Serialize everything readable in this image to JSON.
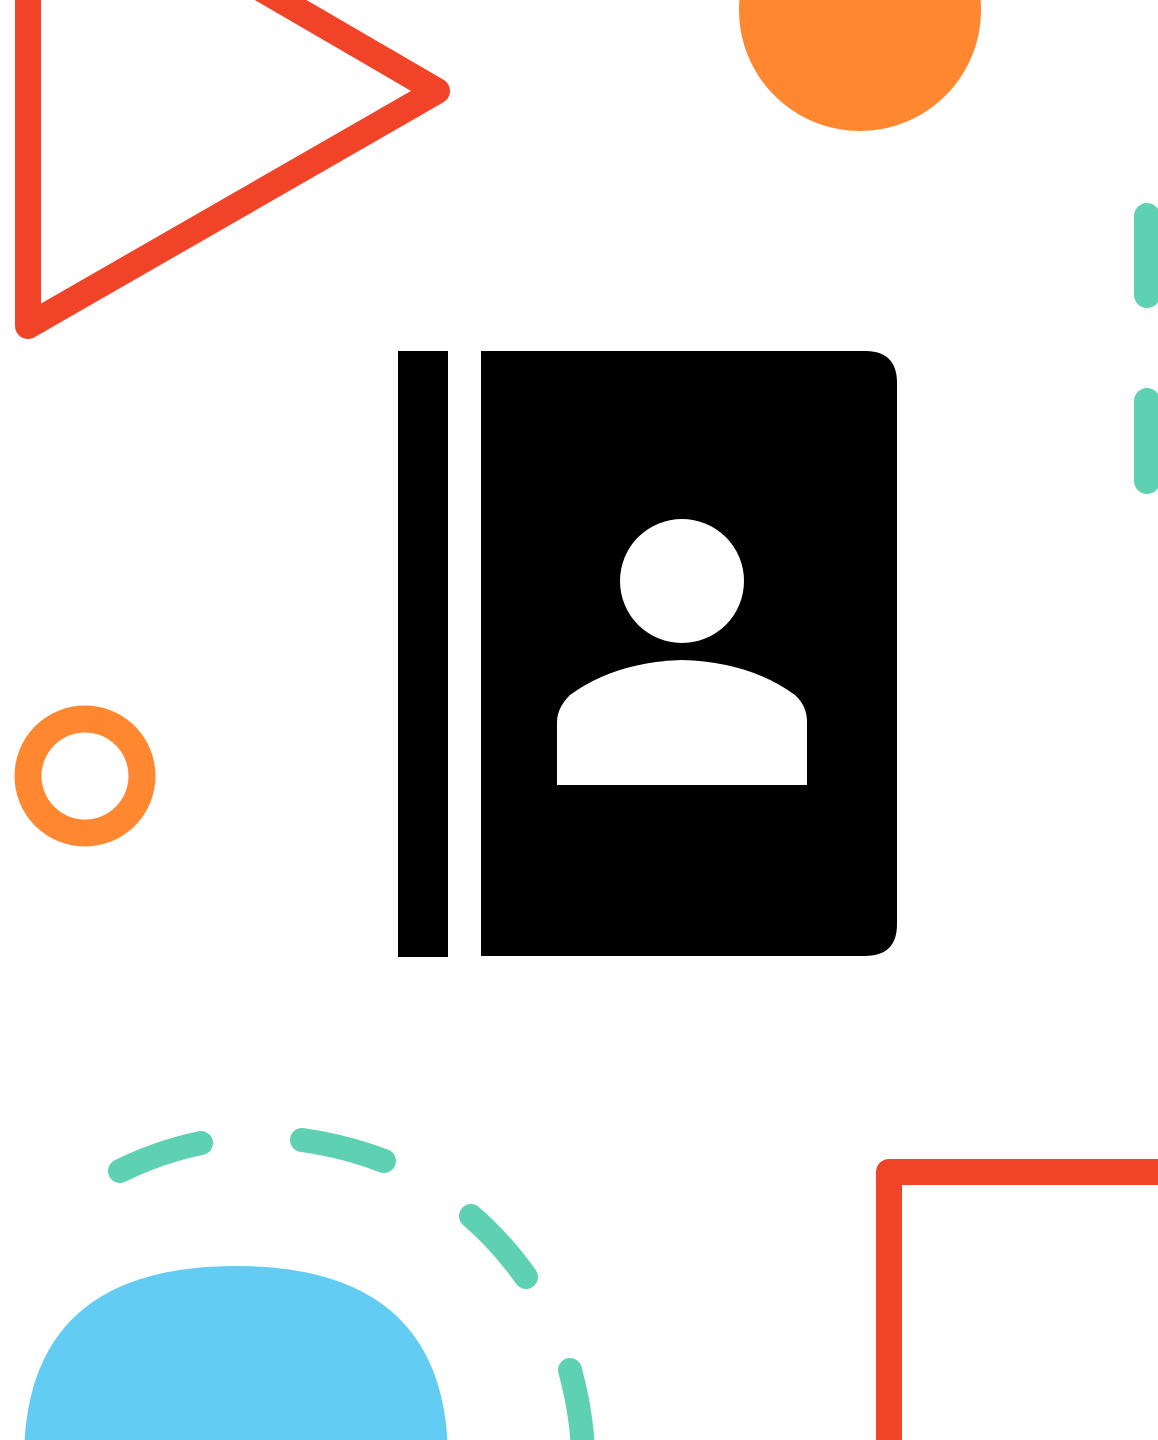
{
  "illustration": {
    "main_icon": "contact-book-icon",
    "decorations": [
      "triangle-outline",
      "orange-circle",
      "teal-dashes",
      "orange-ring",
      "teal-dashed-arc",
      "blue-semicircle",
      "red-square-outline"
    ]
  },
  "colors": {
    "background": "#ffffff",
    "icon": "#000000",
    "icon_detail": "#ffffff",
    "red": "#f04328",
    "orange": "#ff872f",
    "teal": "#5fd1b3",
    "blue": "#62ccf2"
  }
}
